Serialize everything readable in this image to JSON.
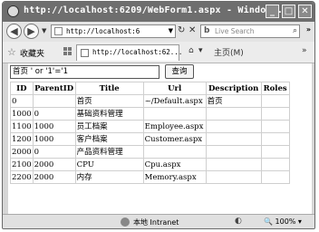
{
  "window": {
    "title": "http://localhost:6209/WebForm1.aspx - Windo...",
    "minimize_glyph": "_",
    "maximize_glyph": "□",
    "close_glyph": "✕"
  },
  "nav": {
    "back_glyph": "◀",
    "forward_glyph": "▶",
    "address": "http://localhost:6",
    "search_placeholder": "Live Search",
    "search_logo": "b",
    "search_glyph": "⌕",
    "refresh_glyph": "↻",
    "stop_glyph": "✕",
    "more_glyph": "»"
  },
  "favorites": {
    "label": "收藏夹",
    "tab_title": "http://localhost:62...",
    "home_label": "主页(M)",
    "page_label": "»"
  },
  "query": {
    "input_value": "首页 ' or '1'='1",
    "button_label": "查询"
  },
  "table": {
    "headers": [
      "ID",
      "ParentID",
      "Title",
      "Url",
      "Description",
      "Roles"
    ],
    "rows": [
      [
        "0",
        "",
        "首页",
        "~/Default.aspx",
        "首页",
        ""
      ],
      [
        "1000",
        "0",
        "基础资料管理",
        "",
        "",
        ""
      ],
      [
        "1100",
        "1000",
        "员工档案",
        "Employee.aspx",
        "",
        ""
      ],
      [
        "1200",
        "1000",
        "客户档案",
        "Customer.aspx",
        "",
        ""
      ],
      [
        "2000",
        "0",
        "产品资料管理",
        "",
        "",
        ""
      ],
      [
        "2100",
        "2000",
        "CPU",
        "Cpu.aspx",
        "",
        ""
      ],
      [
        "2200",
        "2000",
        "内存",
        "Memory.aspx",
        "",
        ""
      ]
    ]
  },
  "status": {
    "zone": "本地 Intranet",
    "zoom": "100%"
  },
  "colors": {
    "titlebar": "#6e6e6e",
    "chrome": "#e4e4e4"
  }
}
